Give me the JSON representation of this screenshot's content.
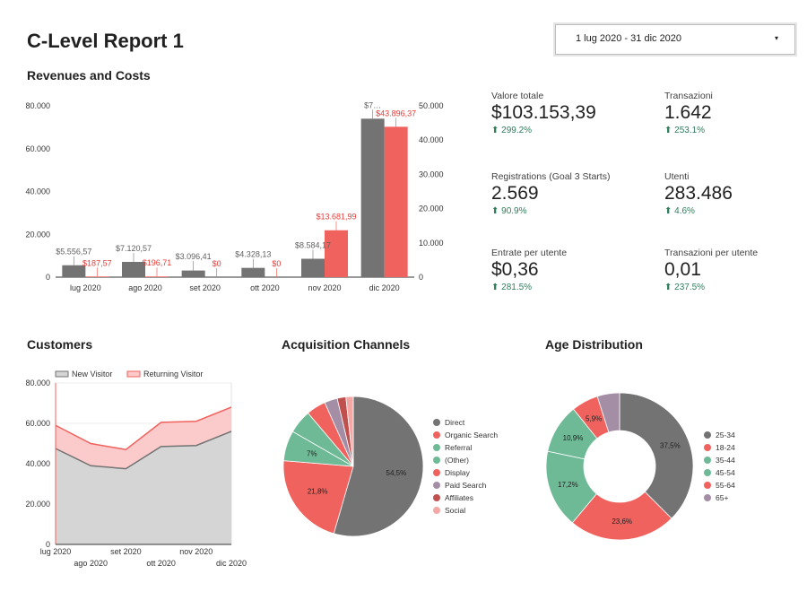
{
  "report_title": "C-Level Report 1",
  "date_range": {
    "value": "1 lug 2020 - 31 dic 2020",
    "caret": "▾"
  },
  "sections": {
    "revenues": "Revenues and Costs",
    "customers": "Customers",
    "channels": "Acquisition Channels",
    "age": "Age Distribution"
  },
  "kpis": [
    {
      "label": "Valore totale",
      "value": "$103.153,39",
      "delta": "⬆ 299.2%"
    },
    {
      "label": "Transazioni",
      "value": "1.642",
      "delta": "⬆ 253.1%"
    },
    {
      "label": "Registrations (Goal 3 Starts)",
      "value": "2.569",
      "delta": "⬆ 90.9%"
    },
    {
      "label": "Utenti",
      "value": "283.486",
      "delta": "⬆ 4.6%"
    },
    {
      "label": "Entrate per utente",
      "value": "$0,36",
      "delta": "⬆ 281.5%"
    },
    {
      "label": "Transazioni per utente",
      "value": "0,01",
      "delta": "⬆ 237.5%"
    }
  ],
  "colors": {
    "gray": "#737373",
    "red": "#f0625e",
    "green": "#6fba96",
    "purple": "#a48ea6",
    "grayArea": "#d5d5d5",
    "pinkArea": "#fbcaca"
  },
  "chart_data": [
    {
      "type": "bar",
      "categories": [
        "lug 2020",
        "ago 2020",
        "set 2020",
        "ott 2020",
        "nov 2020",
        "dic 2020"
      ],
      "ylim": [
        0,
        80000
      ],
      "y_ticks": [
        "0",
        "20.000",
        "40.000",
        "60.000",
        "80.000"
      ],
      "y2lim": [
        0,
        50000
      ],
      "y2_ticks": [
        "0",
        "10.000",
        "20.000",
        "30.000",
        "40.000",
        "50.000"
      ],
      "series": [
        {
          "axis": "left",
          "values": [
            5556.57,
            7120.57,
            3096.41,
            4328.13,
            8584.17,
            74000
          ],
          "labels": [
            "$5.556,57",
            "$7.120,57",
            "$3.096,41",
            "$4.328,13",
            "$8.584,17",
            "$7…"
          ]
        },
        {
          "axis": "right",
          "values": [
            187.57,
            196.71,
            0,
            0,
            13681.99,
            43896.37
          ],
          "labels": [
            "$187,57",
            "$196,71",
            "$0",
            "$0",
            "$13.681,99",
            "$43.896,37"
          ]
        }
      ]
    },
    {
      "type": "area",
      "categories": [
        "lug 2020",
        "ago 2020",
        "set 2020",
        "ott 2020",
        "nov 2020",
        "dic 2020"
      ],
      "ylim": [
        0,
        80000
      ],
      "y_ticks": [
        "0",
        "20.000",
        "40.000",
        "60.000",
        "80.000"
      ],
      "legend_position": "top-left",
      "series": [
        {
          "name": "New Visitor",
          "values": [
            47500,
            39000,
            37500,
            48500,
            49000,
            56000
          ]
        },
        {
          "name": "Returning Visitor",
          "values": [
            11500,
            11000,
            9500,
            12000,
            12000,
            12000
          ]
        }
      ]
    },
    {
      "type": "pie",
      "legend_position": "right",
      "slices": [
        {
          "name": "Direct",
          "value": 54.5,
          "label": "54,5%"
        },
        {
          "name": "Organic Search",
          "value": 21.8,
          "label": "21,8%"
        },
        {
          "name": "Referral",
          "value": 7,
          "label": "7%"
        },
        {
          "name": "(Other)",
          "value": 5.5
        },
        {
          "name": "Display",
          "value": 4.5
        },
        {
          "name": "Paid Search",
          "value": 3
        },
        {
          "name": "Affiliates",
          "value": 2
        },
        {
          "name": "Social",
          "value": 1.7
        }
      ]
    },
    {
      "type": "pie",
      "donut": true,
      "legend_position": "right",
      "slices": [
        {
          "name": "25-34",
          "value": 37.5,
          "label": "37,5%"
        },
        {
          "name": "18-24",
          "value": 23.6,
          "label": "23,6%"
        },
        {
          "name": "35-44",
          "value": 17.2,
          "label": "17,2%"
        },
        {
          "name": "45-54",
          "value": 10.9,
          "label": "10,9%"
        },
        {
          "name": "55-64",
          "value": 5.9,
          "label": "5,9%"
        },
        {
          "name": "65+",
          "value": 4.9
        }
      ]
    }
  ]
}
